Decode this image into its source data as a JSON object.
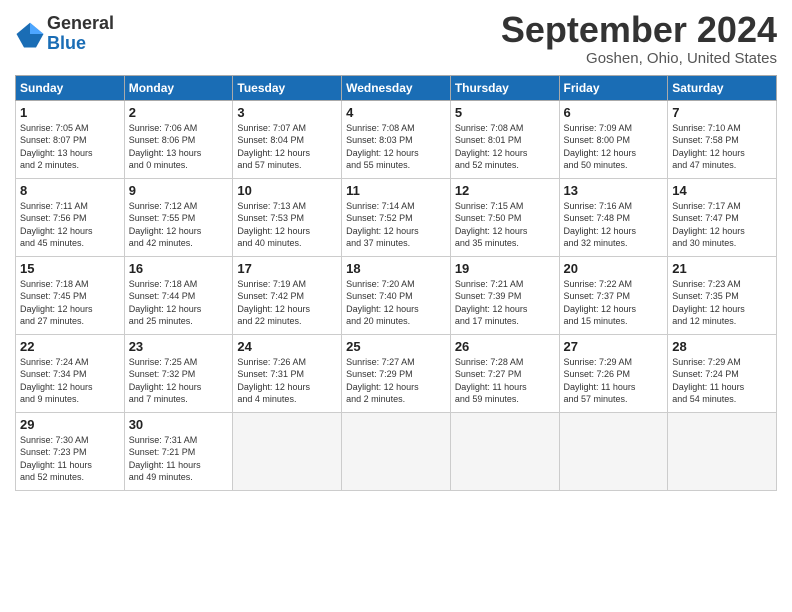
{
  "logo": {
    "general": "General",
    "blue": "Blue"
  },
  "title": "September 2024",
  "location": "Goshen, Ohio, United States",
  "headers": [
    "Sunday",
    "Monday",
    "Tuesday",
    "Wednesday",
    "Thursday",
    "Friday",
    "Saturday"
  ],
  "weeks": [
    [
      {
        "day": "1",
        "info": "Sunrise: 7:05 AM\nSunset: 8:07 PM\nDaylight: 13 hours\nand 2 minutes."
      },
      {
        "day": "2",
        "info": "Sunrise: 7:06 AM\nSunset: 8:06 PM\nDaylight: 13 hours\nand 0 minutes."
      },
      {
        "day": "3",
        "info": "Sunrise: 7:07 AM\nSunset: 8:04 PM\nDaylight: 12 hours\nand 57 minutes."
      },
      {
        "day": "4",
        "info": "Sunrise: 7:08 AM\nSunset: 8:03 PM\nDaylight: 12 hours\nand 55 minutes."
      },
      {
        "day": "5",
        "info": "Sunrise: 7:08 AM\nSunset: 8:01 PM\nDaylight: 12 hours\nand 52 minutes."
      },
      {
        "day": "6",
        "info": "Sunrise: 7:09 AM\nSunset: 8:00 PM\nDaylight: 12 hours\nand 50 minutes."
      },
      {
        "day": "7",
        "info": "Sunrise: 7:10 AM\nSunset: 7:58 PM\nDaylight: 12 hours\nand 47 minutes."
      }
    ],
    [
      {
        "day": "8",
        "info": "Sunrise: 7:11 AM\nSunset: 7:56 PM\nDaylight: 12 hours\nand 45 minutes."
      },
      {
        "day": "9",
        "info": "Sunrise: 7:12 AM\nSunset: 7:55 PM\nDaylight: 12 hours\nand 42 minutes."
      },
      {
        "day": "10",
        "info": "Sunrise: 7:13 AM\nSunset: 7:53 PM\nDaylight: 12 hours\nand 40 minutes."
      },
      {
        "day": "11",
        "info": "Sunrise: 7:14 AM\nSunset: 7:52 PM\nDaylight: 12 hours\nand 37 minutes."
      },
      {
        "day": "12",
        "info": "Sunrise: 7:15 AM\nSunset: 7:50 PM\nDaylight: 12 hours\nand 35 minutes."
      },
      {
        "day": "13",
        "info": "Sunrise: 7:16 AM\nSunset: 7:48 PM\nDaylight: 12 hours\nand 32 minutes."
      },
      {
        "day": "14",
        "info": "Sunrise: 7:17 AM\nSunset: 7:47 PM\nDaylight: 12 hours\nand 30 minutes."
      }
    ],
    [
      {
        "day": "15",
        "info": "Sunrise: 7:18 AM\nSunset: 7:45 PM\nDaylight: 12 hours\nand 27 minutes."
      },
      {
        "day": "16",
        "info": "Sunrise: 7:18 AM\nSunset: 7:44 PM\nDaylight: 12 hours\nand 25 minutes."
      },
      {
        "day": "17",
        "info": "Sunrise: 7:19 AM\nSunset: 7:42 PM\nDaylight: 12 hours\nand 22 minutes."
      },
      {
        "day": "18",
        "info": "Sunrise: 7:20 AM\nSunset: 7:40 PM\nDaylight: 12 hours\nand 20 minutes."
      },
      {
        "day": "19",
        "info": "Sunrise: 7:21 AM\nSunset: 7:39 PM\nDaylight: 12 hours\nand 17 minutes."
      },
      {
        "day": "20",
        "info": "Sunrise: 7:22 AM\nSunset: 7:37 PM\nDaylight: 12 hours\nand 15 minutes."
      },
      {
        "day": "21",
        "info": "Sunrise: 7:23 AM\nSunset: 7:35 PM\nDaylight: 12 hours\nand 12 minutes."
      }
    ],
    [
      {
        "day": "22",
        "info": "Sunrise: 7:24 AM\nSunset: 7:34 PM\nDaylight: 12 hours\nand 9 minutes."
      },
      {
        "day": "23",
        "info": "Sunrise: 7:25 AM\nSunset: 7:32 PM\nDaylight: 12 hours\nand 7 minutes."
      },
      {
        "day": "24",
        "info": "Sunrise: 7:26 AM\nSunset: 7:31 PM\nDaylight: 12 hours\nand 4 minutes."
      },
      {
        "day": "25",
        "info": "Sunrise: 7:27 AM\nSunset: 7:29 PM\nDaylight: 12 hours\nand 2 minutes."
      },
      {
        "day": "26",
        "info": "Sunrise: 7:28 AM\nSunset: 7:27 PM\nDaylight: 11 hours\nand 59 minutes."
      },
      {
        "day": "27",
        "info": "Sunrise: 7:29 AM\nSunset: 7:26 PM\nDaylight: 11 hours\nand 57 minutes."
      },
      {
        "day": "28",
        "info": "Sunrise: 7:29 AM\nSunset: 7:24 PM\nDaylight: 11 hours\nand 54 minutes."
      }
    ],
    [
      {
        "day": "29",
        "info": "Sunrise: 7:30 AM\nSunset: 7:23 PM\nDaylight: 11 hours\nand 52 minutes."
      },
      {
        "day": "30",
        "info": "Sunrise: 7:31 AM\nSunset: 7:21 PM\nDaylight: 11 hours\nand 49 minutes."
      },
      {
        "day": "",
        "info": ""
      },
      {
        "day": "",
        "info": ""
      },
      {
        "day": "",
        "info": ""
      },
      {
        "day": "",
        "info": ""
      },
      {
        "day": "",
        "info": ""
      }
    ]
  ]
}
